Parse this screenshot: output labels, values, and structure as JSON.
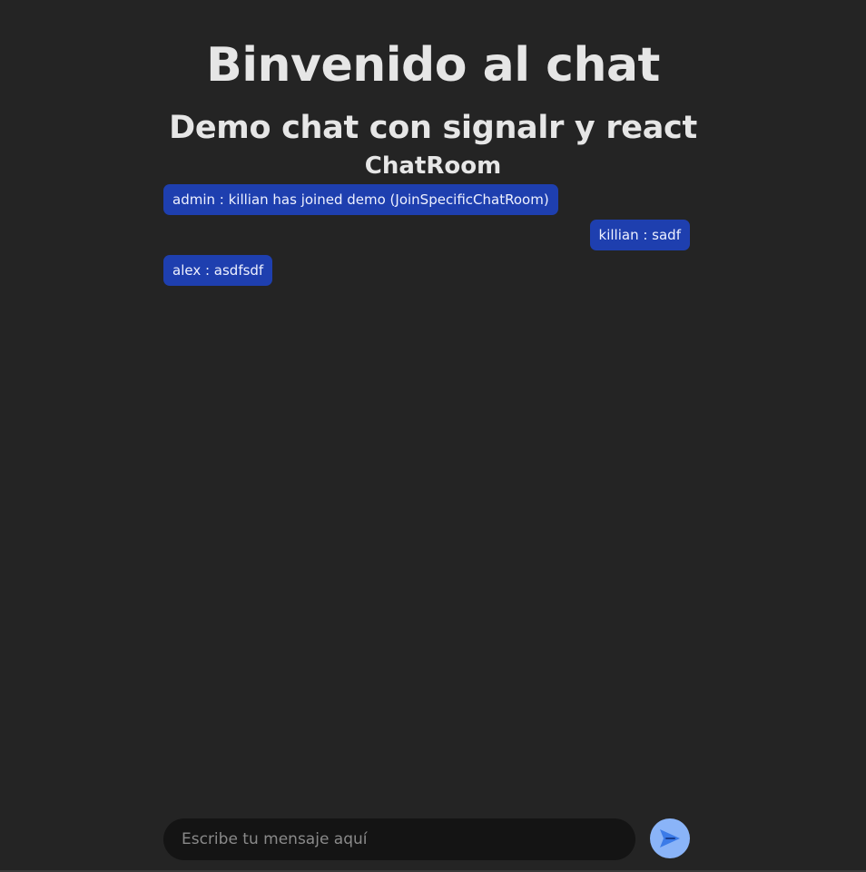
{
  "header": {
    "title": "Binvenido al chat",
    "subtitle": "Demo chat con signalr y react",
    "room": "ChatRoom"
  },
  "messages": [
    {
      "text": "admin : killian has joined demo (JoinSpecificChatRoom)",
      "align": "left"
    },
    {
      "text": "killian : sadf",
      "align": "right"
    },
    {
      "text": "alex : asdfsdf",
      "align": "left"
    }
  ],
  "composer": {
    "placeholder": "Escribe tu mensaje aquí",
    "value": "",
    "send_icon": "send-icon"
  },
  "colors": {
    "background": "#242424",
    "bubble": "#1e3faf",
    "input_bg": "#141414",
    "send_button": "#8ab4f8",
    "send_glyph": "#2f6fe0"
  }
}
